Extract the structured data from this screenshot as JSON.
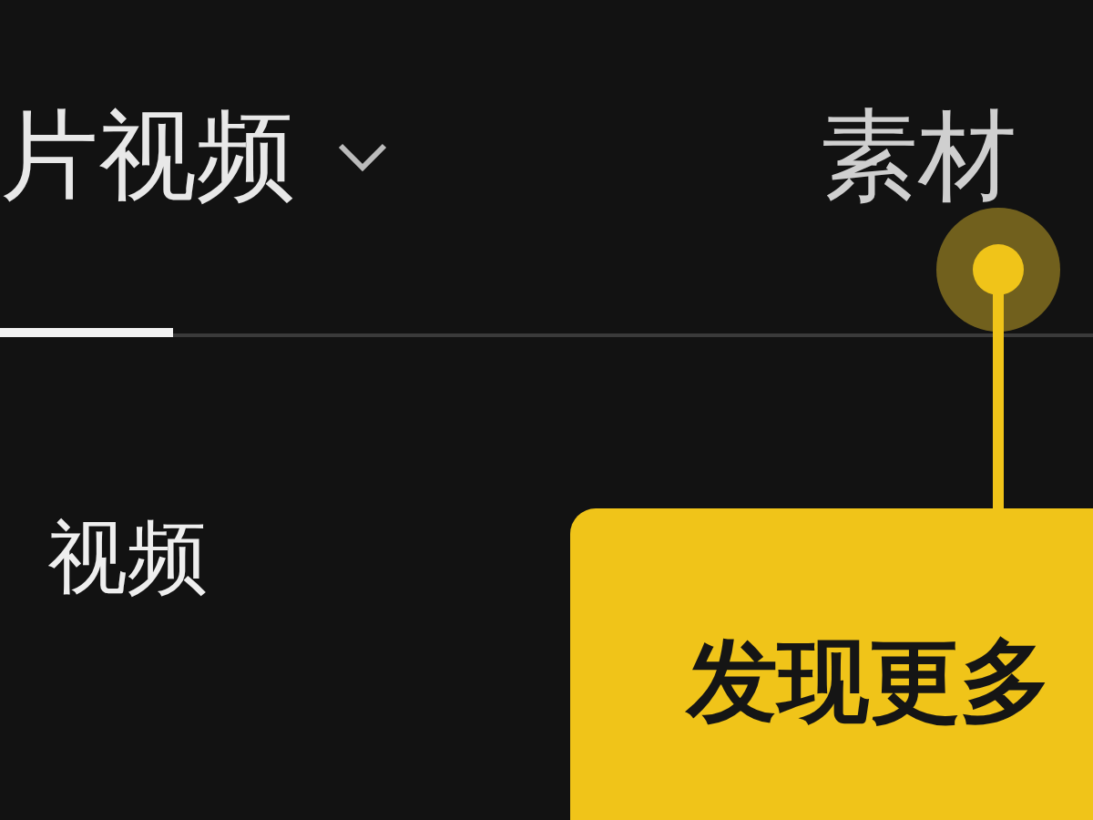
{
  "tabs": [
    {
      "label": "片视频",
      "selected": true,
      "dropdown": true
    },
    {
      "label": "素材",
      "selected": false,
      "dropdown": false
    }
  ],
  "list_item": "视频",
  "tooltip": {
    "text": "发现更多"
  }
}
